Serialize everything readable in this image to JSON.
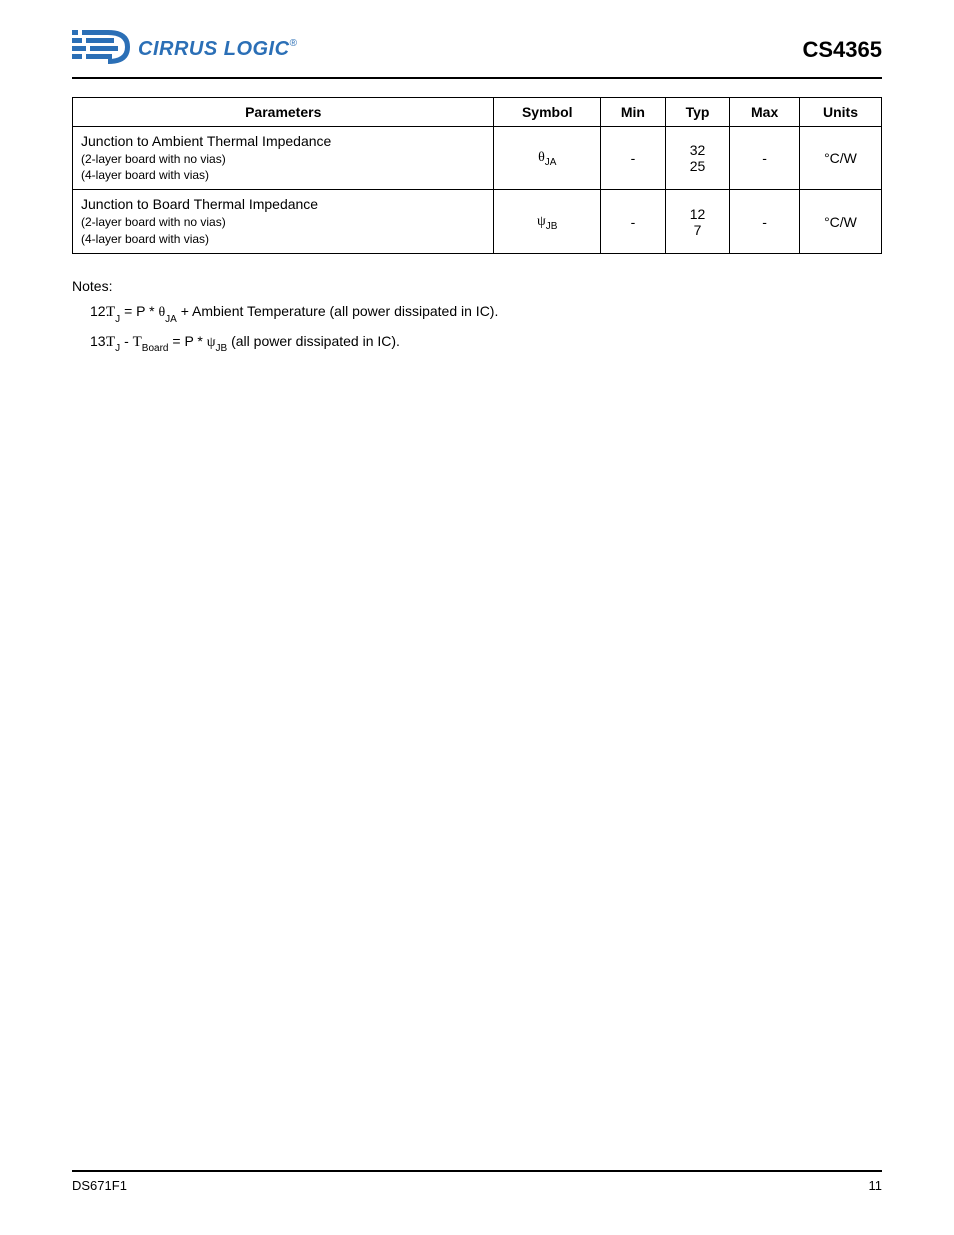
{
  "header": {
    "logo_text": "CIRRUS LOGIC",
    "logo_reg": "®",
    "part_number": "CS4365"
  },
  "table": {
    "headers": [
      "Parameters",
      "Symbol",
      "Min",
      "Typ",
      "Max",
      "Units"
    ],
    "rows": [
      {
        "param_main": "Junction to Ambient Thermal Impedance",
        "param_sub": "(2-layer board with no vias)\n(4-layer board with vias)",
        "symbol_greek": "θ",
        "symbol_sub": "JA",
        "min": "-",
        "typ_line1": "32",
        "typ_line2": "25",
        "max": "-",
        "units": "°C/W"
      },
      {
        "param_main": "Junction to Board Thermal Impedance",
        "param_sub": "(2-layer board with no vias)\n(4-layer board with vias)",
        "symbol_greek": "ψ",
        "symbol_sub": "JB",
        "min": "-",
        "typ_line1": "12",
        "typ_line2": "7",
        "max": "-",
        "units": "°C/W"
      }
    ]
  },
  "notes": {
    "title": "Notes:",
    "items": [
      {
        "num": "12.",
        "prefix": "",
        "expr_T": "T",
        "expr_sub": "J",
        "expr_mid": " = P * ",
        "expr_greek": "θ",
        "expr_greek_sub": "JA",
        "expr_after": " + Ambient Temperature (all power dissipated in IC)."
      },
      {
        "num": "13.",
        "prefix": "",
        "expr_T": "T",
        "expr_sub": "J",
        "expr_mid": " - ",
        "expr_T2": "T",
        "expr_sub2": "Board",
        "expr_eq": " = P * ",
        "expr_greek": "ψ",
        "expr_greek_sub": "JB",
        "expr_after": " (all power dissipated in IC)."
      }
    ]
  },
  "footer": {
    "left": "DS671F1",
    "right": "11"
  }
}
